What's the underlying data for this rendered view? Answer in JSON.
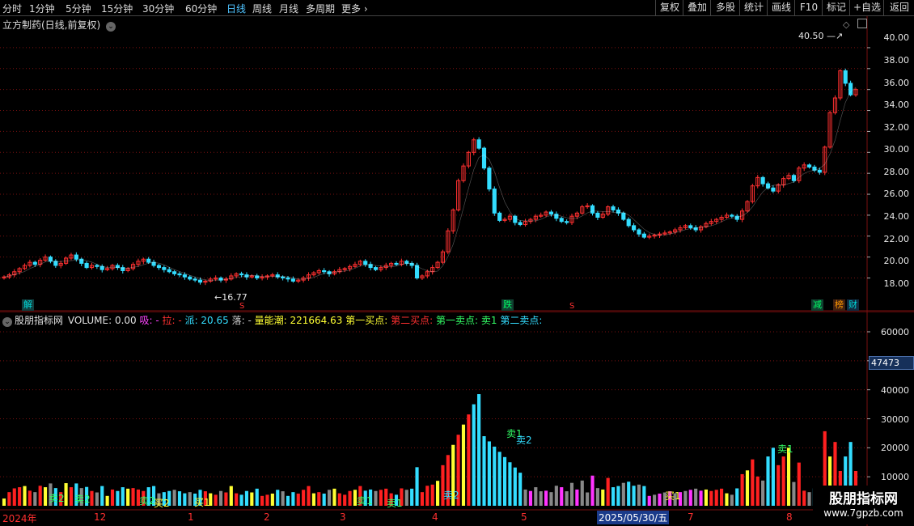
{
  "toolbar": {
    "timeframes": [
      "分时",
      "1分钟",
      "5分钟",
      "15分钟",
      "30分钟",
      "60分钟",
      "日线",
      "周线",
      "月线",
      "多周期",
      "更多"
    ],
    "active_timeframe": "日线",
    "right_buttons": [
      "复权",
      "叠加",
      "多股",
      "统计",
      "画线",
      "F10",
      "+自选",
      "返回"
    ],
    "mark_label": "标记"
  },
  "main": {
    "title": "立方制药(日线,前复权)",
    "max_annotation": "40.50",
    "min_annotation": "16.77",
    "y_ticks": [
      "40.00",
      "38.00",
      "36.00",
      "34.00",
      "32.00",
      "30.00",
      "28.00",
      "26.00",
      "24.00",
      "22.00",
      "20.00",
      "18.00"
    ],
    "badges": [
      {
        "text": "解",
        "color": "#00d8d8",
        "bg": "#104040"
      },
      {
        "text": "S",
        "color": "#ff3030"
      },
      {
        "text": "跌",
        "color": "#00ff66",
        "bg": "#104030"
      },
      {
        "text": "S",
        "color": "#ff3030"
      },
      {
        "text": "减",
        "color": "#00ff66",
        "bg": "#104030"
      },
      {
        "text": "榜",
        "color": "#ff9900",
        "bg": "#402010"
      },
      {
        "text": "财",
        "color": "#00d8d8",
        "bg": "#102a40"
      }
    ]
  },
  "indicator": {
    "name": "股朋指标网",
    "items": [
      {
        "text": "VOLUME: 0.00",
        "color": "#e0e0e0"
      },
      {
        "text": "吸: -",
        "color": "#ff44ff"
      },
      {
        "text": "拉: -",
        "color": "#ff3030"
      },
      {
        "text": "派: 20.65",
        "color": "#33ddff"
      },
      {
        "text": "落: -",
        "color": "#cccccc"
      },
      {
        "text": "量能潮: 221664.63",
        "color": "#ffff33"
      },
      {
        "text": "第一买点:",
        "color": "#ffff33"
      },
      {
        "text": "第二买点:",
        "color": "#ff3030"
      },
      {
        "text": "第一卖点: 卖1",
        "color": "#33ff66"
      },
      {
        "text": "第二卖点:",
        "color": "#33ddff"
      }
    ],
    "y_ticks": [
      "60000",
      "50000",
      "40000",
      "30000",
      "20000",
      "10000"
    ],
    "current_value": "47473",
    "signals": [
      "卖1",
      "卖2",
      "买1",
      "买2"
    ]
  },
  "date_axis": {
    "labels": [
      "2024年",
      "12",
      "1",
      "2",
      "3",
      "4",
      "5",
      "2025/05/30/五",
      "7",
      "8"
    ]
  },
  "watermark": {
    "line1": "股朋指标网",
    "line2": "www.7gpzb.com"
  },
  "colors": {
    "up": "#ff3030",
    "down": "#33ddff",
    "grid": "#7a1010",
    "flat": "#888888"
  },
  "chart_data": {
    "type": "candlestick",
    "y_range": [
      17,
      41
    ],
    "closes": [
      18.1,
      18.3,
      18.6,
      18.9,
      19.2,
      19.5,
      19.3,
      19.7,
      20.0,
      19.6,
      19.2,
      19.4,
      19.9,
      20.2,
      19.8,
      19.4,
      19.0,
      19.2,
      19.1,
      18.8,
      18.9,
      19.2,
      19.0,
      18.7,
      18.9,
      19.3,
      19.6,
      19.8,
      19.5,
      19.2,
      19.0,
      18.8,
      18.6,
      18.4,
      18.3,
      18.1,
      17.9,
      17.8,
      17.6,
      17.7,
      17.9,
      18.0,
      17.8,
      17.9,
      18.2,
      18.4,
      18.3,
      18.1,
      18.2,
      18.0,
      18.1,
      18.2,
      18.3,
      18.1,
      18.0,
      17.9,
      17.7,
      17.8,
      18.0,
      18.3,
      18.5,
      18.7,
      18.6,
      18.4,
      18.6,
      18.8,
      18.9,
      19.1,
      19.3,
      19.6,
      19.3,
      19.0,
      18.8,
      19.0,
      19.2,
      19.4,
      19.3,
      19.6,
      19.4,
      19.2,
      18.0,
      18.2,
      18.6,
      19.0,
      19.5,
      20.5,
      22.5,
      24.5,
      27.3,
      28.7,
      30.0,
      31.2,
      30.4,
      28.5,
      26.5,
      24.2,
      23.5,
      23.6,
      23.9,
      23.3,
      23.1,
      23.4,
      23.6,
      23.9,
      24.0,
      24.3,
      24.1,
      23.7,
      23.4,
      23.3,
      23.9,
      24.2,
      24.8,
      24.9,
      24.2,
      23.8,
      24.1,
      24.8,
      24.5,
      24.2,
      23.6,
      23.0,
      22.6,
      22.2,
      21.9,
      22.0,
      22.1,
      22.2,
      22.3,
      22.4,
      22.6,
      22.8,
      23.0,
      22.8,
      22.6,
      22.9,
      23.2,
      23.4,
      23.6,
      23.8,
      24.0,
      23.9,
      23.6,
      24.4,
      25.3,
      26.8,
      27.6,
      27.0,
      26.6,
      26.3,
      26.9,
      27.5,
      27.8,
      27.3,
      28.5,
      28.8,
      28.6,
      28.3,
      28.1,
      30.5,
      33.8,
      35.2,
      37.8,
      36.6,
      35.5,
      36.0
    ],
    "ma_colors": [
      "#ffffff",
      "#ffff33"
    ]
  }
}
